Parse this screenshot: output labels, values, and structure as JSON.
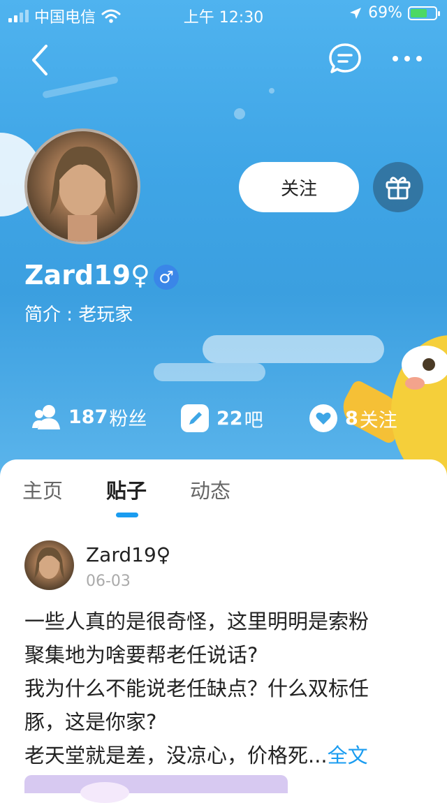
{
  "status_bar": {
    "carrier": "中国电信",
    "time": "上午 12:30",
    "battery_percent": "69%",
    "battery_level": 0.69
  },
  "profile": {
    "username": "Zard19♀",
    "gender_badge": "♂",
    "bio": "简介 : 老玩家",
    "follow_label": "关注"
  },
  "stats": {
    "fans": {
      "num": "187",
      "label": "粉丝"
    },
    "bars": {
      "num": "22",
      "label": "吧"
    },
    "following": {
      "num": "8",
      "label": "关注"
    }
  },
  "tabs": [
    {
      "label": "主页"
    },
    {
      "label": "贴子"
    },
    {
      "label": "动态"
    }
  ],
  "post": {
    "author": "Zard19♀",
    "date": "06-03",
    "lines": [
      "一些人真的是很奇怪，这里明明是索粉",
      "聚集地为啥要帮老任说话?",
      "我为什么不能说老任缺点？什么双标任",
      "豚，这是你家?",
      "老天堂就是差，没凉心，价格死..."
    ],
    "more_label": "全文"
  },
  "colors": {
    "accent": "#1a9cf0",
    "cover_top": "#4fb3ef",
    "gender_badge": "#3a86e8"
  }
}
